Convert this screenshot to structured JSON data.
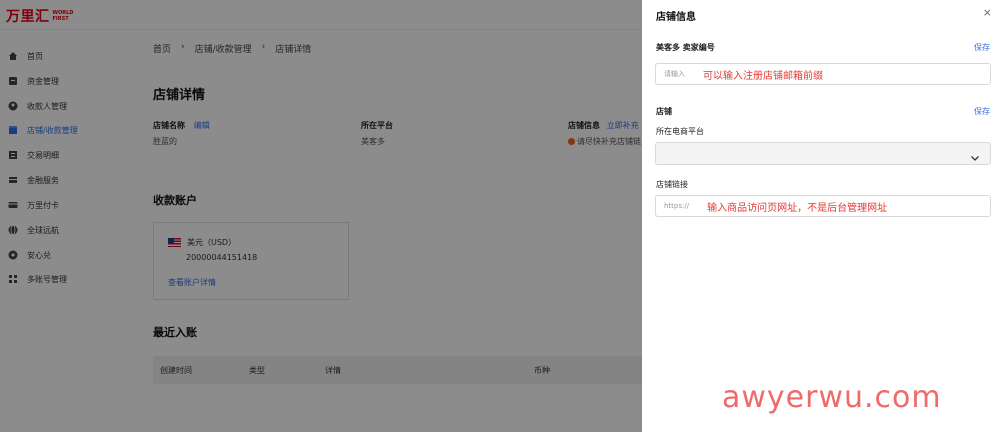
{
  "brand": {
    "cn": "万里汇",
    "en": "WORLD FIRST",
    "color": "#e60012"
  },
  "sidebar": {
    "items": [
      {
        "label": "首页",
        "icon": "home-icon"
      },
      {
        "label": "资金管理",
        "icon": "wallet-icon"
      },
      {
        "label": "收款人管理",
        "icon": "user-icon"
      },
      {
        "label": "店铺/收款管理",
        "icon": "store-icon",
        "active": true
      },
      {
        "label": "交易明细",
        "icon": "list-icon"
      },
      {
        "label": "金融服务",
        "icon": "finance-icon"
      },
      {
        "label": "万里付卡",
        "icon": "card-icon"
      },
      {
        "label": "全球远航",
        "icon": "globe-icon"
      },
      {
        "label": "安心兑",
        "icon": "exchange-icon"
      },
      {
        "label": "多账号管理",
        "icon": "accounts-icon"
      }
    ]
  },
  "breadcrumb": {
    "home": "首页",
    "sep": "›",
    "section": "店铺/收款管理",
    "current": "店铺详情"
  },
  "page": {
    "title": "店铺详情"
  },
  "info": {
    "shop_name_label": "店铺名称",
    "edit_link": "编辑",
    "shop_name_value": "胜蓝的",
    "platform_label": "所在平台",
    "platform_value": "美客多",
    "shop_info_label": "店铺信息",
    "fill_link": "立即补充",
    "shop_info_value": "请尽快补充店铺链"
  },
  "account": {
    "section_title": "收款账户",
    "currency": "美元（USD）",
    "number": "20000044151418",
    "detail_link": "查看账户详情"
  },
  "recent": {
    "section_title": "最近入账",
    "columns": [
      "创建时间",
      "类型",
      "详情",
      "币种"
    ]
  },
  "drawer": {
    "title": "店铺信息",
    "close": "×",
    "seller_id_label": "美客多 卖家编号",
    "save1": "保存",
    "seller_input_placeholder": "请输入",
    "seller_note": "可以输入注册店铺邮箱前缀",
    "shop_section": "店铺",
    "save2": "保存",
    "platform_label": "所在电商平台",
    "link_label": "店铺链接",
    "link_placeholder": "https://",
    "link_note": "输入商品访问页网址，不是后台管理网址"
  },
  "watermark": "awyerwu.com",
  "colors": {
    "accent": "#2f6fea",
    "note": "#e53935",
    "warning": "#e8661b"
  }
}
